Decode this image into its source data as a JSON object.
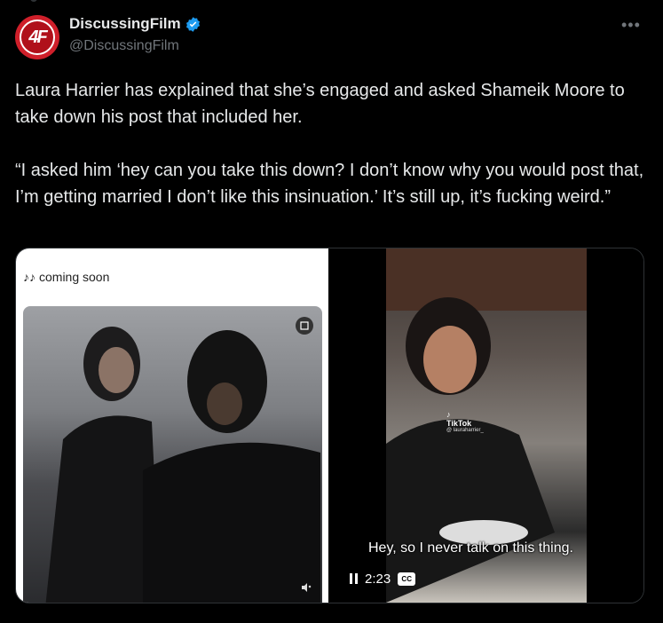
{
  "author": {
    "display_name": "DiscussingFilm",
    "handle": "@DiscussingFilm",
    "avatar_text": "4F",
    "verified": true
  },
  "menu": {
    "more_label": "•••"
  },
  "tweet": {
    "paragraphs": [
      "Laura Harrier has explained that she’s engaged and asked Shameik Moore to take down his post that included her.",
      "“I asked him ‘hey can you take this down? I don’t know why you would post that, I’m getting married I don’t like this insinuation.’ It’s still up, it’s fucking weird.”"
    ]
  },
  "media": {
    "left": {
      "note_icon": "♪♪",
      "header_text": "coming soon"
    },
    "right": {
      "watermark_brand": "TikTok",
      "watermark_user": "@ lauraharrier_",
      "caption": "Hey, so I never talk on this thing.",
      "time": "2:23",
      "cc_label": "CC"
    }
  },
  "colors": {
    "background": "#000000",
    "text": "#e7e9ea",
    "muted": "#71767b",
    "verified": "#1d9bf0",
    "brand_red": "#cf1f2a"
  }
}
